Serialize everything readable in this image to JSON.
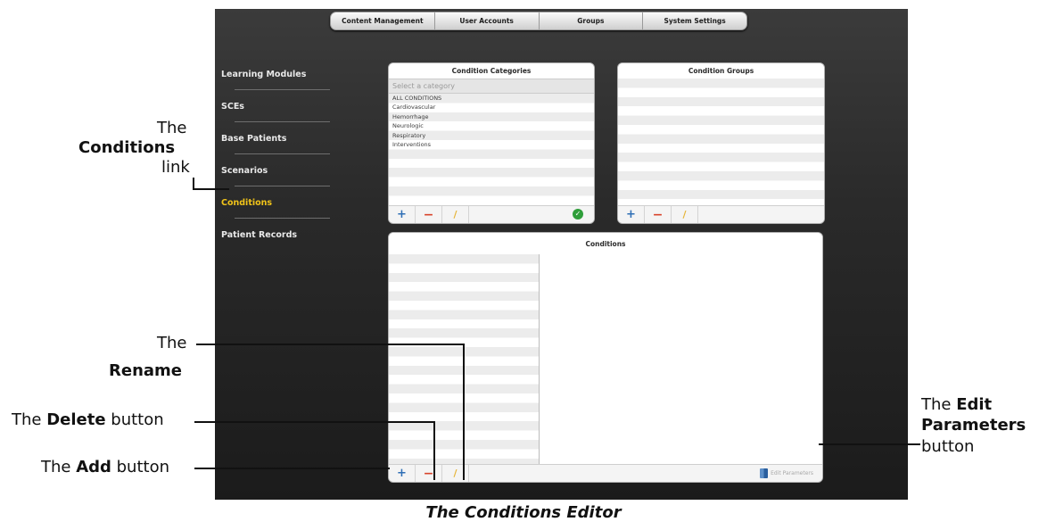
{
  "top_tabs": [
    "Content Management",
    "User Accounts",
    "Groups",
    "System Settings"
  ],
  "nav_items": [
    "Learning Modules",
    "SCEs",
    "Base Patients",
    "Scenarios",
    "Conditions",
    "Patient Records"
  ],
  "active_nav": "Conditions",
  "condition_categories": {
    "title": "Condition Categories",
    "select_placeholder": "Select a category",
    "items": [
      "ALL CONDITIONS",
      "Cardiovascular",
      "Hemorrhage",
      "Neurologic",
      "Respiratory",
      "Interventions"
    ]
  },
  "condition_groups": {
    "title": "Condition Groups"
  },
  "conditions": {
    "title": "Conditions",
    "edit_parameters_label": "Edit Parameters"
  },
  "toolbar": {
    "add_symbol": "+",
    "delete_symbol": "−",
    "rename_symbol": "/",
    "ok_symbol": "✓"
  },
  "annotations": {
    "conditions_link": {
      "line1": "The",
      "line2": "Conditions",
      "line3": "link"
    },
    "rename": {
      "line1": "The",
      "line2": "Rename"
    },
    "delete": {
      "prefix": "The ",
      "bold": "Delete",
      "suffix": " button"
    },
    "add": {
      "prefix": "The ",
      "bold": "Add",
      "suffix": " button"
    },
    "edit_params": {
      "line1_prefix": "The ",
      "line1_bold": "Edit",
      "line2_bold": "Parameters",
      "line3": "button"
    }
  },
  "caption": "The Conditions Editor",
  "colors": {
    "active_nav": "#f0c319",
    "add_icon": "#2f6fb6",
    "delete_icon": "#d8432b",
    "rename_icon": "#e6b53a",
    "ok_icon": "#2f9e3a"
  }
}
